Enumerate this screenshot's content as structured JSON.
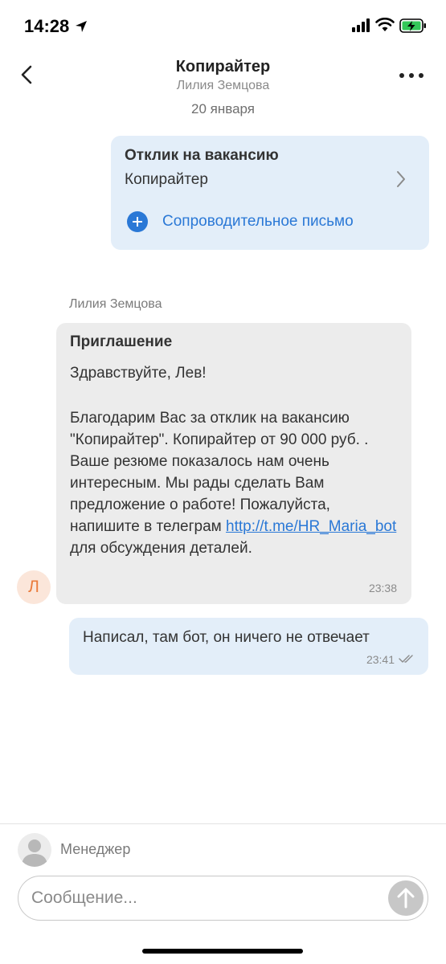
{
  "status_bar": {
    "time": "14:28",
    "location_icon": "location-arrow-icon",
    "signal_icon": "cellular-signal-icon",
    "wifi_icon": "wifi-icon",
    "battery_icon": "battery-charging-icon",
    "battery_color": "#34c759"
  },
  "header": {
    "title": "Копирайтер",
    "subtitle": "Лилия Земцова",
    "back_icon": "chevron-left-icon",
    "more_icon": "more-horizontal-icon"
  },
  "chat": {
    "date": "20 января",
    "application": {
      "title": "Отклик на вакансию",
      "vacancy": "Копирайтер",
      "cover_letter": "Сопроводительное письмо",
      "accent_color": "#2a78d6"
    },
    "incoming": {
      "sender": "Лилия Земцова",
      "avatar_letter": "Л",
      "title": "Приглашение",
      "greeting": "Здравствуйте, Лев!",
      "body_before_link": "Благодарим Вас за отклик на вакансию \"Копирайтер\". Копирайтер от 90 000 руб. . Ваше резюме показалось нам очень интересным. Мы рады сделать Вам предложение о работе! Пожалуйста, напишите в телеграм ",
      "link": "http://t.me/HR_Maria_bot",
      "body_after_link": "  для обсуждения деталей.",
      "time": "23:38"
    },
    "outgoing": {
      "text": "Написал, там бот, он ничего не отвечает",
      "time": "23:41",
      "status_icon": "double-check-icon"
    }
  },
  "composer": {
    "manager_label": "Менеджер",
    "placeholder": "Сообщение...",
    "send_icon": "arrow-up-icon"
  }
}
